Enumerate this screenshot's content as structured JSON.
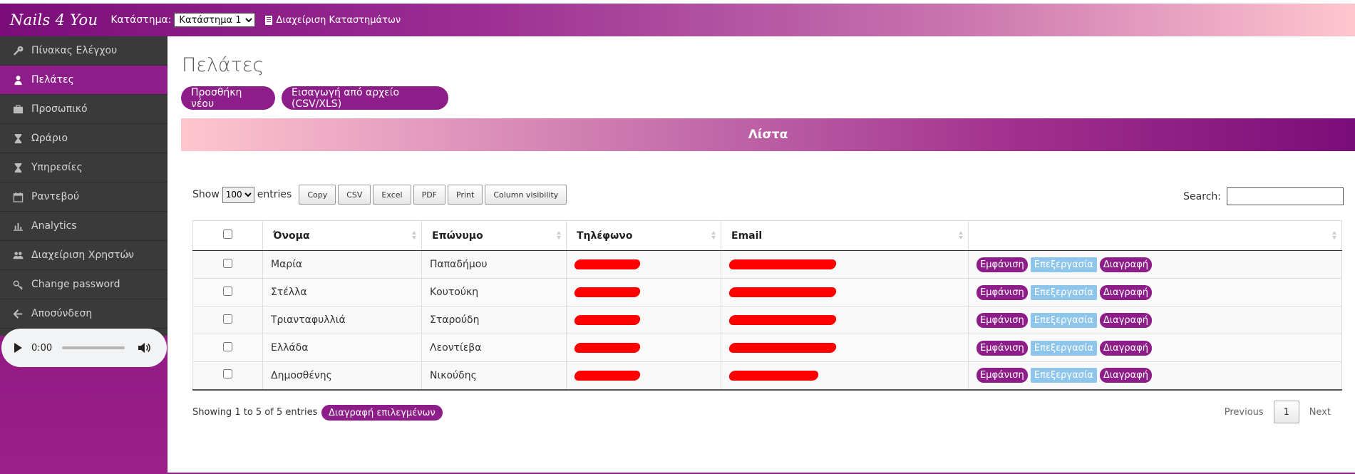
{
  "header": {
    "brand": "Nails 4 You",
    "store_label": "Κατάστημα:",
    "store_selected": "Κατάστημα 1",
    "manage_stores": "Διαχείριση Καταστημάτων"
  },
  "sidebar": {
    "items": [
      {
        "label": "Πίνακας Ελέγχου",
        "icon": "wrench-icon"
      },
      {
        "label": "Πελάτες",
        "icon": "user-icon"
      },
      {
        "label": "Προσωπικό",
        "icon": "briefcase-icon"
      },
      {
        "label": "Ωράριο",
        "icon": "hourglass-icon"
      },
      {
        "label": "Υπηρεσίες",
        "icon": "hourglass-icon"
      },
      {
        "label": "Ραντεβού",
        "icon": "calendar-icon"
      },
      {
        "label": "Analytics",
        "icon": "bar-chart-icon"
      },
      {
        "label": "Διαχείριση Χρηστών",
        "icon": "users-icon"
      },
      {
        "label": "Change password",
        "icon": "key-icon"
      },
      {
        "label": "Αποσύνδεση",
        "icon": "arrow-left-icon"
      }
    ],
    "audio": {
      "time": "0:00"
    }
  },
  "main": {
    "title": "Πελάτες",
    "add_button": "Προσθήκη νέου",
    "import_button": "Εισαγωγή από αρχείο (CSV/XLS)",
    "list_banner": "Λίστα",
    "show_label": "Show",
    "entries_label": "entries",
    "page_length": "100",
    "export_buttons": [
      "Copy",
      "CSV",
      "Excel",
      "PDF",
      "Print",
      "Column visibility"
    ],
    "search_label": "Search:",
    "columns": [
      "Όνομα",
      "Επώνυμο",
      "Τηλέφωνο",
      "Email"
    ],
    "rows": [
      {
        "first": "Μαρία",
        "last": "Παπαδήμου"
      },
      {
        "first": "Στέλλα",
        "last": "Κουτούκη"
      },
      {
        "first": "Τριανταφυλλιά",
        "last": "Σταρούδη"
      },
      {
        "first": "Ελλάδα",
        "last": "Λεοντίεβα"
      },
      {
        "first": "Δημοσθένης",
        "last": "Νικούδης"
      }
    ],
    "actions": {
      "view": "Εμφάνιση",
      "edit": "Επεξεργασία",
      "delete": "Διαγραφή"
    },
    "info": "Showing 1 to 5 of 5 entries",
    "delete_selected": "Διαγραφή επιλεγμένων",
    "pager": {
      "previous": "Previous",
      "current": "1",
      "next": "Next"
    }
  },
  "colors": {
    "accent": "#8d1d88",
    "edit": "#8ec5ea",
    "sidebar_bg": "#3a3a3a"
  }
}
